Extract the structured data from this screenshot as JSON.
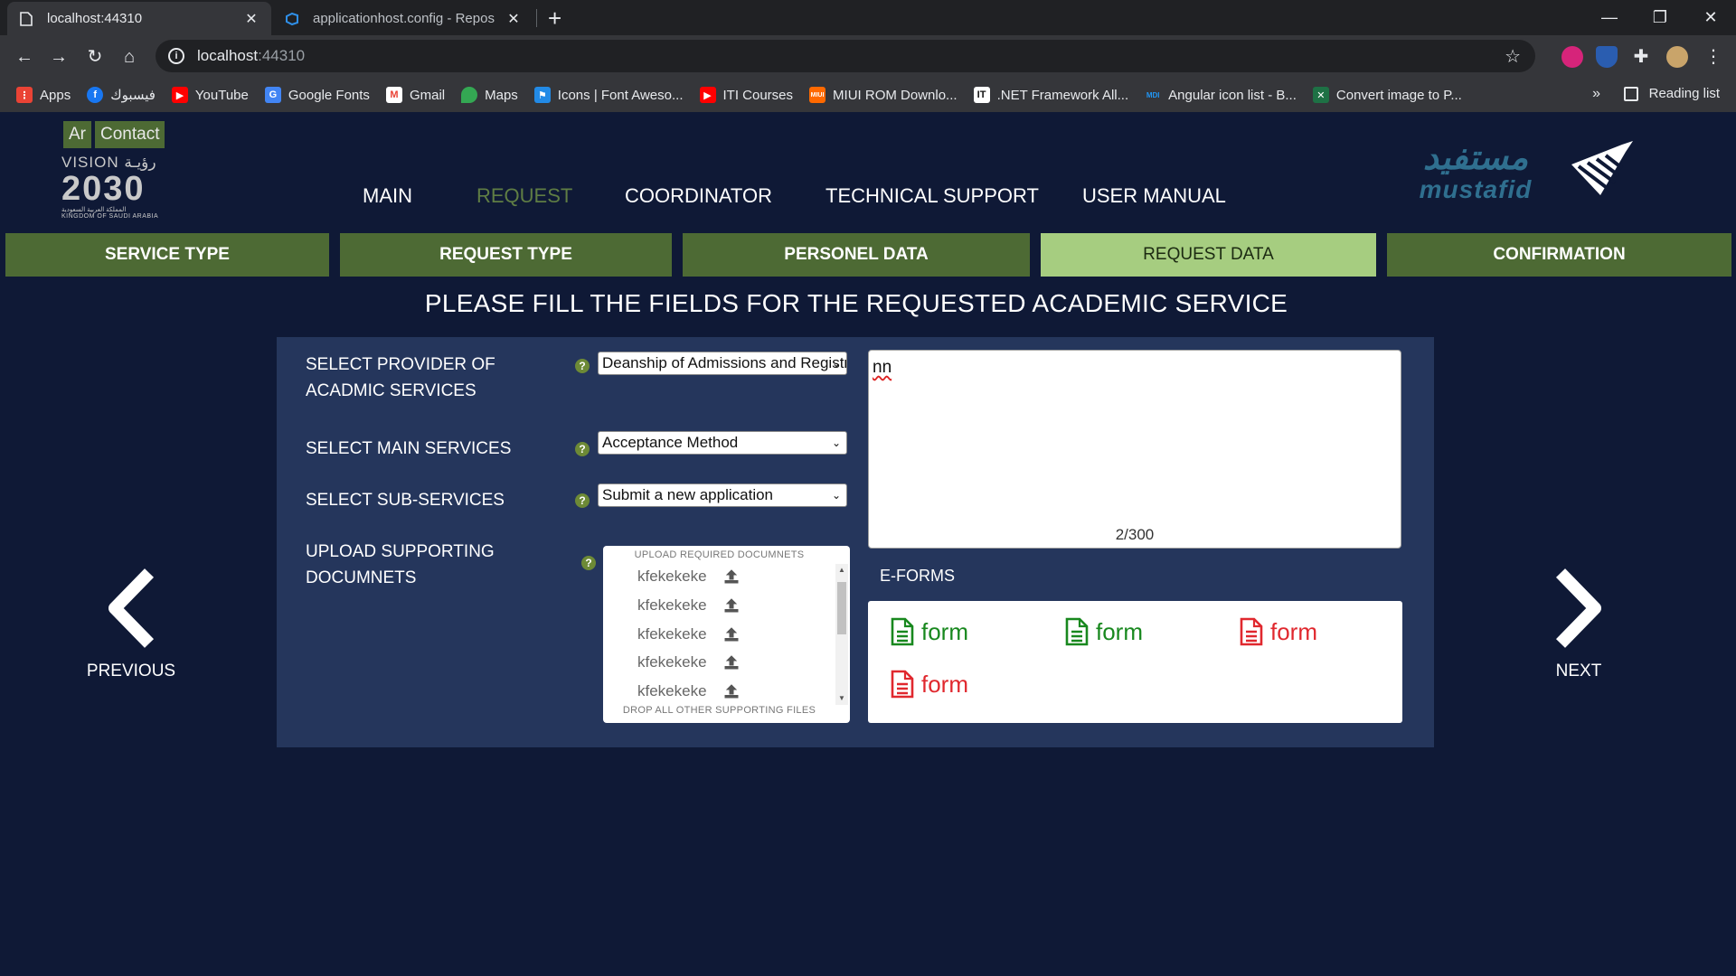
{
  "browser": {
    "tabs": [
      {
        "title": "localhost:44310",
        "active": true
      },
      {
        "title": "applicationhost.config - Repos",
        "active": false
      }
    ],
    "url_host": "localhost",
    "url_port": ":44310",
    "bookmarks": [
      {
        "label": "Apps",
        "icon": "apps-grid-icon",
        "color": "#ea4335"
      },
      {
        "label": "فيسبوك",
        "icon": "facebook-icon",
        "color": "#1877f2"
      },
      {
        "label": "YouTube",
        "icon": "youtube-icon",
        "color": "#ff0000"
      },
      {
        "label": "Google Fonts",
        "icon": "google-fonts-icon",
        "color": "#4285f4"
      },
      {
        "label": "Gmail",
        "icon": "gmail-icon",
        "color": "#ea4335"
      },
      {
        "label": "Maps",
        "icon": "maps-pin-icon",
        "color": "#34a853"
      },
      {
        "label": "Icons | Font Aweso...",
        "icon": "font-awesome-flag-icon",
        "color": "#228ae6"
      },
      {
        "label": "ITI Courses",
        "icon": "youtube-icon",
        "color": "#ff0000"
      },
      {
        "label": "MIUI ROM Downlo...",
        "icon": "miui-icon",
        "color": "#ff6900"
      },
      {
        "label": ".NET Framework All...",
        "icon": "it-icon",
        "color": "#ffffff"
      },
      {
        "label": "Angular icon list - B...",
        "icon": "mdi-icon",
        "color": "#2196f3"
      },
      {
        "label": "Convert image to P...",
        "icon": "convert-icon",
        "color": "#1e7145"
      }
    ],
    "bookmarks_more": "»",
    "reading_list": "Reading list"
  },
  "header": {
    "lang_button": "Ar",
    "contact_button": "Contact",
    "vision_line1": "VISION رؤيـة",
    "vision_year": "2030",
    "vision_sub": "المملكة العربية السعودية",
    "vision_kingdom": "KINGDOM OF SAUDI ARABIA",
    "mustafid_ar": "مستفيد",
    "mustafid_en": "mustafid"
  },
  "nav": {
    "items": [
      {
        "label": "MAIN",
        "active": false
      },
      {
        "label": "REQUEST",
        "active": true
      },
      {
        "label": "COORDINATOR",
        "active": false
      },
      {
        "label": "TECHNICAL SUPPORT",
        "active": false
      },
      {
        "label": "USER MANUAL",
        "active": false
      }
    ]
  },
  "steps": [
    {
      "label": "SERVICE TYPE",
      "current": false
    },
    {
      "label": "REQUEST TYPE",
      "current": false
    },
    {
      "label": "PERSONEL DATA",
      "current": false
    },
    {
      "label": "REQUEST DATA",
      "current": true
    },
    {
      "label": "CONFIRMATION",
      "current": false
    }
  ],
  "heading": "PLEASE FILL THE FIELDS FOR THE REQUESTED ACADEMIC SERVICE",
  "form": {
    "provider_label": "SELECT PROVIDER OF ACADMIC SERVICES",
    "provider_value": "Deanship of Admissions and Registration",
    "main_service_label": "SELECT MAIN SERVICES",
    "main_service_value": "Acceptance Method",
    "sub_service_label": "SELECT SUB-SERVICES",
    "sub_service_value": "Submit a new application",
    "upload_label": "UPLOAD SUPPORTING DOCUMNETS",
    "help_glyph": "?",
    "upload_title": "UPLOAD REQUIRED DOCUMNETS",
    "upload_items": [
      "kfekekeke",
      "kfekekeke",
      "kfekekeke",
      "kfekekeke",
      "kfekekeke"
    ],
    "upload_footer": "DROP ALL OTHER SUPPORTING FILES",
    "notes_value": "nn",
    "char_count": "2/300",
    "eforms_label": "E-FORMS",
    "eforms": [
      {
        "label": "form",
        "status": "green"
      },
      {
        "label": "form",
        "status": "green"
      },
      {
        "label": "form",
        "status": "red"
      },
      {
        "label": "form",
        "status": "red"
      }
    ]
  },
  "pager": {
    "previous": "PREVIOUS",
    "next": "NEXT"
  },
  "colors": {
    "page_bg": "#0f1936",
    "panel_bg": "#25365c",
    "step_bg": "#4d6a34",
    "step_current_bg": "#a6cd80",
    "nav_active": "#5f7d44",
    "form_ok": "#18881e",
    "form_missing": "#e0282e"
  }
}
